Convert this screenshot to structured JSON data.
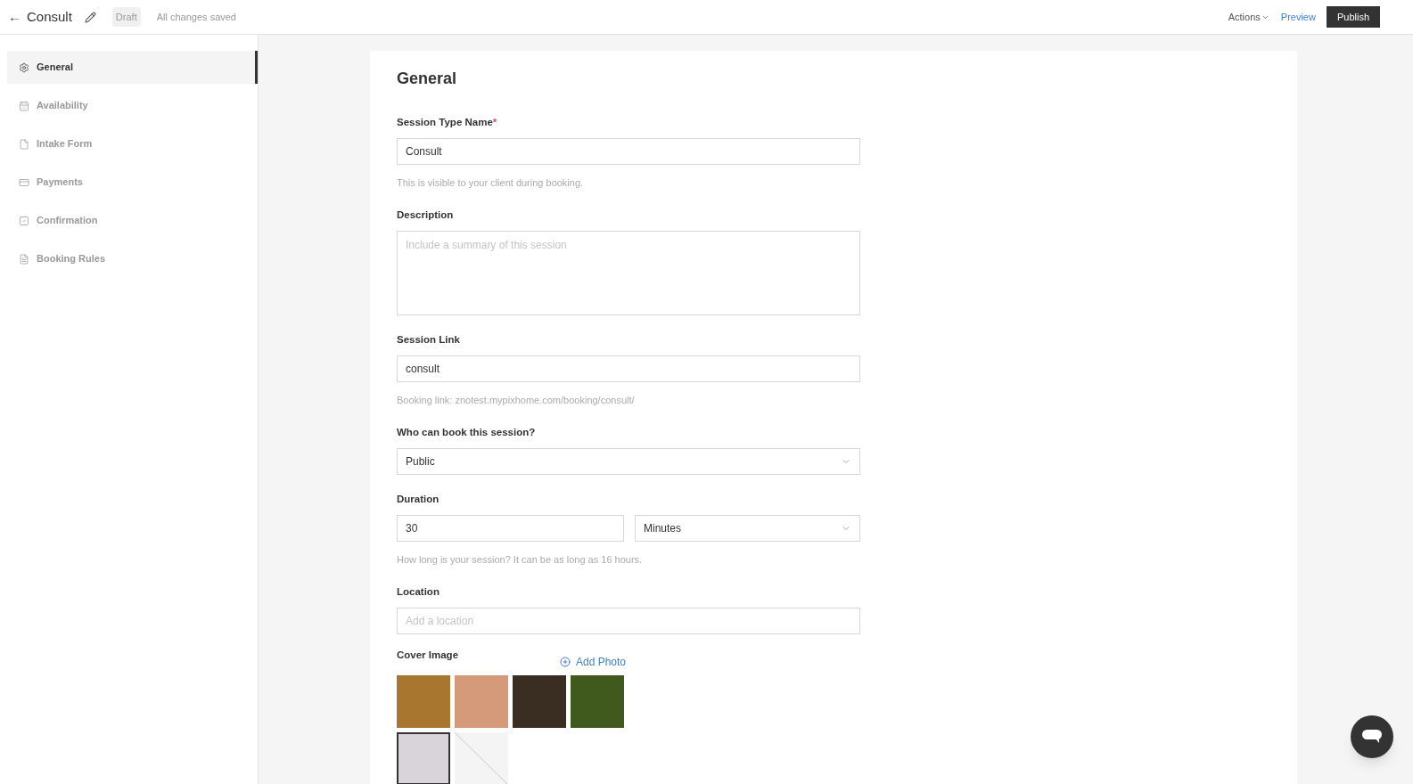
{
  "header": {
    "back": "←",
    "title": "Consult",
    "status": "Draft",
    "save_state": "All changes saved",
    "actions": "Actions",
    "preview": "Preview",
    "publish": "Publish"
  },
  "sidebar": {
    "items": [
      {
        "label": "General",
        "kind": "gear",
        "selected": true
      },
      {
        "label": "Availability",
        "kind": "calendar",
        "selected": false
      },
      {
        "label": "Intake Form",
        "kind": "file",
        "selected": false
      },
      {
        "label": "Payments",
        "kind": "card",
        "selected": false
      },
      {
        "label": "Confirmation",
        "kind": "check",
        "selected": false
      },
      {
        "label": "Booking Rules",
        "kind": "doc",
        "selected": false
      }
    ]
  },
  "form": {
    "title": "General",
    "required_mark": "*",
    "fields": [
      {
        "kind": "text",
        "label": "Session Type Name",
        "required": true,
        "value": "Consult",
        "hint": "This is visible to your client during booking."
      },
      {
        "kind": "textarea",
        "label": "Description",
        "required": false,
        "placeholder": "Include a summary of this session"
      },
      {
        "kind": "text",
        "label": "Session Link",
        "required": false,
        "value": "consult",
        "hint": "Booking link: znotest.mypixhome.com/booking/consult/"
      },
      {
        "kind": "select",
        "label": "Who can book this session?",
        "required": false,
        "value": "Public"
      },
      {
        "kind": "duration",
        "label": "Duration",
        "required": false,
        "value": "30",
        "unit": "Minutes",
        "hint": "How long is your session? It can be as long as 16 hours."
      },
      {
        "kind": "text",
        "label": "Location",
        "required": false,
        "placeholder": "Add a location"
      }
    ],
    "cover": {
      "label": "Cover Image",
      "add": "Add Photo",
      "images": [
        {
          "kind": "photo",
          "color": "#a8762f",
          "selected": false
        },
        {
          "kind": "photo",
          "color": "#d59a7a",
          "selected": false
        },
        {
          "kind": "photo",
          "color": "#3a2d22",
          "selected": false
        },
        {
          "kind": "photo",
          "color": "#3f5a1c",
          "selected": false
        },
        {
          "kind": "photo",
          "color": "#d9d4da",
          "selected": true
        },
        {
          "kind": "none",
          "color": "#f4f4f4",
          "selected": false
        }
      ]
    }
  }
}
